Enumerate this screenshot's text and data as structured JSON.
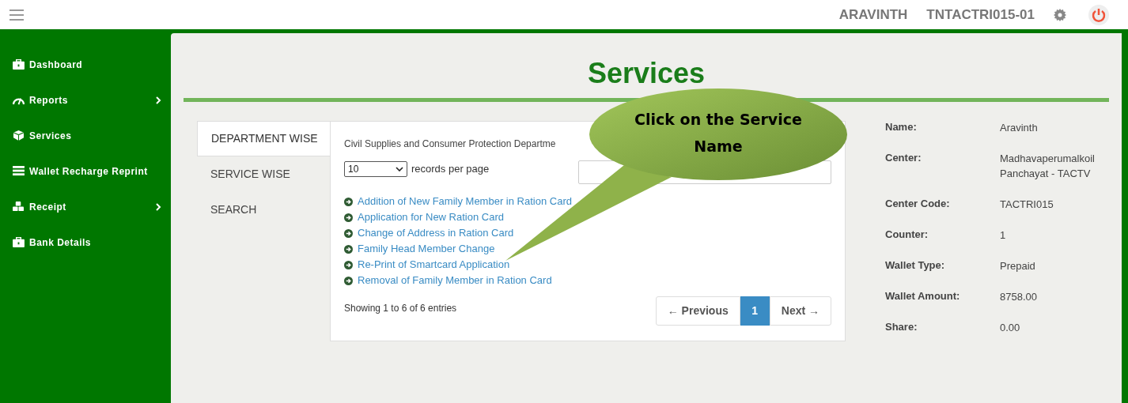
{
  "topbar": {
    "user": "ARAVINTH",
    "terminal": "TNTACTRI015-01"
  },
  "sidebar": {
    "items": [
      {
        "label": "Dashboard",
        "kind": "briefcase",
        "has_submenu": false
      },
      {
        "label": "Reports",
        "kind": "gauge",
        "has_submenu": true
      },
      {
        "label": "Services",
        "kind": "cube",
        "has_submenu": false
      },
      {
        "label": "Wallet Recharge Reprint",
        "kind": "list",
        "has_submenu": false
      },
      {
        "label": "Receipt",
        "kind": "cubes",
        "has_submenu": true
      },
      {
        "label": "Bank Details",
        "kind": "briefcase",
        "has_submenu": false
      }
    ]
  },
  "page_title": "Services",
  "tabs": [
    {
      "label": "DEPARTMENT WISE",
      "selected": true
    },
    {
      "label": "SERVICE WISE",
      "selected": false
    },
    {
      "label": "SEARCH",
      "selected": false
    }
  ],
  "department": "Civil Supplies and Consumer Protection Departme",
  "page_size": {
    "value": "10",
    "suffix": "records per page"
  },
  "services": [
    "Addition of New Family Member in Ration Card",
    "Application for New Ration Card",
    "Change of Address in Ration Card",
    "Family Head Member Change",
    "Re-Print of Smartcard Application",
    "Removal of Family Member in Ration Card"
  ],
  "entries_info": "Showing 1 to 6 of 6 entries",
  "pagination": {
    "previous": "← Previous",
    "pages": [
      {
        "label": "1",
        "selected": true
      }
    ],
    "next": "Next →"
  },
  "details": [
    {
      "label": "Name:",
      "value": "Aravinth"
    },
    {
      "label": "Center:",
      "value": "Madhavaperumalkoil Panchayat - TACTV"
    },
    {
      "label": "Center Code:",
      "value": "TACTRI015"
    },
    {
      "label": "Counter:",
      "value": "1"
    },
    {
      "label": "Wallet Type:",
      "value": "Prepaid"
    },
    {
      "label": "Wallet Amount:",
      "value": "8758.00"
    },
    {
      "label": "Share:",
      "value": "0.00"
    }
  ],
  "callout": {
    "text": "Click on the Service Name"
  }
}
